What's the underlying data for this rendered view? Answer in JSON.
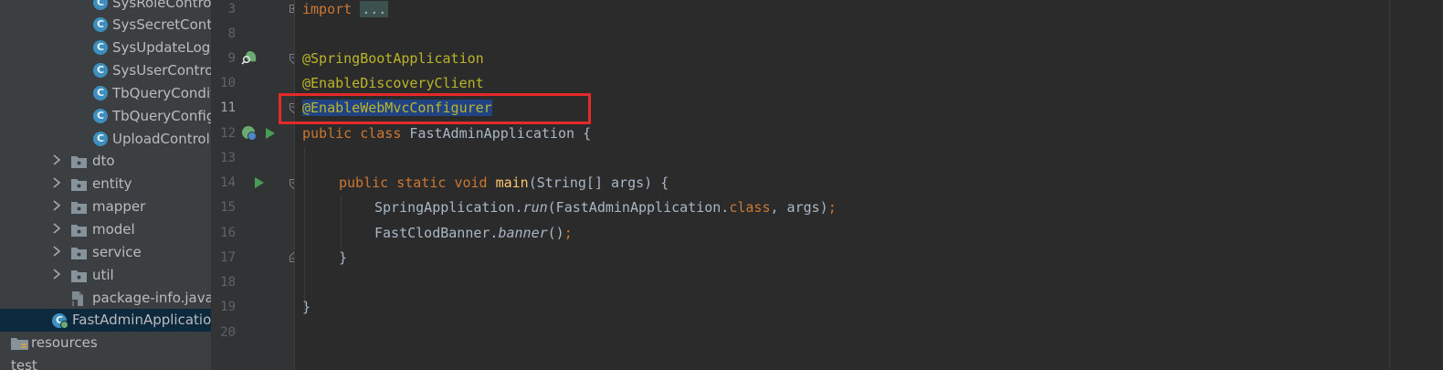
{
  "project_tree": {
    "classes": [
      {
        "name": "SysRoleContro",
        "icon": "class-icon"
      },
      {
        "name": "SysSecretContr",
        "icon": "class-icon"
      },
      {
        "name": "SysUpdateLogC",
        "icon": "class-icon"
      },
      {
        "name": "SysUserContro",
        "icon": "class-icon"
      },
      {
        "name": "TbQueryCondit",
        "icon": "class-icon"
      },
      {
        "name": "TbQueryConfig",
        "icon": "class-icon"
      },
      {
        "name": "UploadControl",
        "icon": "class-icon"
      }
    ],
    "packages": [
      "dto",
      "entity",
      "mapper",
      "model",
      "service",
      "util"
    ],
    "package_info": "package-info.java",
    "main_class": "FastAdminApplicatio",
    "resources": "resources",
    "test": "test",
    "class_icon_letter": "C"
  },
  "editor": {
    "line_numbers": [
      "3",
      "8",
      "9",
      "10",
      "11",
      "12",
      "13",
      "14",
      "15",
      "16",
      "17",
      "18",
      "19",
      "20"
    ],
    "current_line": "11",
    "code": {
      "l3": {
        "kw": "import",
        "folded": "..."
      },
      "l9": "@SpringBootApplication",
      "l10": "@EnableDiscoveryClient",
      "l11": "@EnableWebMvcConfigurer",
      "l12": {
        "kw1": "public",
        "kw2": "class",
        "name": "FastAdminApplication",
        "brace": "{"
      },
      "l14": {
        "kw1": "public",
        "kw2": "static",
        "kw3": "void",
        "method": "main",
        "params": "(String[] args) {"
      },
      "l15": {
        "recv": "SpringApplication.",
        "call": "run",
        "open": "(FastAdminApplication.",
        "kw": "class",
        "rest": ", args)",
        "semi": ";"
      },
      "l16": {
        "recv": "FastClodBanner.",
        "call": "banner",
        "rest": "()",
        "semi": ";"
      },
      "l17": "}",
      "l19": "}"
    }
  },
  "colors": {
    "keyword": "#cc7832",
    "annotation": "#bbb529",
    "method": "#ffc66d",
    "text": "#a9b7c6",
    "selection": "#214283",
    "highlight_box": "#e52a2a"
  }
}
